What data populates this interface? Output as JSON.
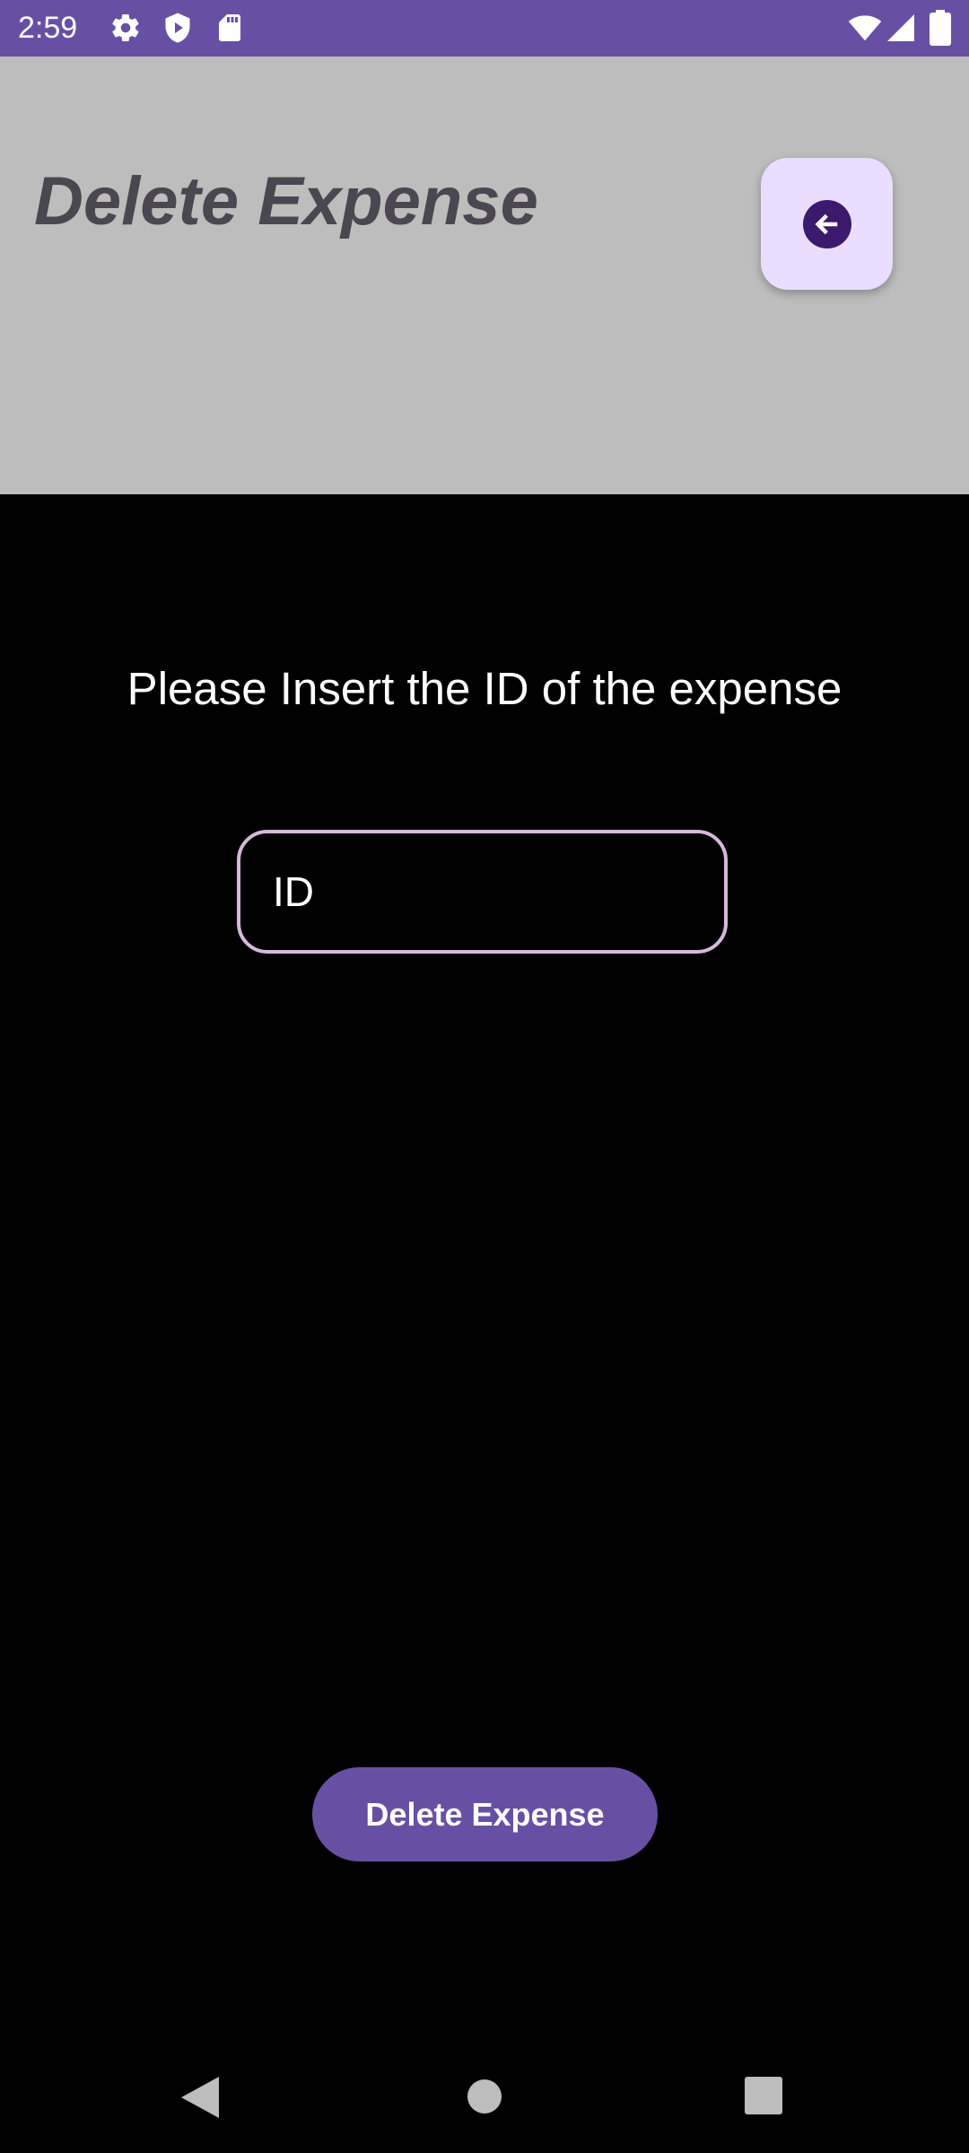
{
  "status_bar": {
    "time": "2:59",
    "left_icons": [
      "settings-icon",
      "shield-play-icon",
      "sd-card-icon"
    ],
    "right_icons": [
      "wifi-icon",
      "signal-icon",
      "battery-icon"
    ],
    "color": "#6750a4"
  },
  "header": {
    "title": "Delete Expense",
    "back_button_icon": "arrow-left-circle-icon",
    "background": "#bdbdbd"
  },
  "form": {
    "prompt": "Please Insert the ID of the expense",
    "id_placeholder": "ID",
    "id_value": ""
  },
  "actions": {
    "delete_label": "Delete Expense",
    "accent": "#6750a4"
  },
  "nav_bar": {
    "icons": [
      "back-triangle-icon",
      "home-circle-icon",
      "recents-square-icon"
    ]
  }
}
